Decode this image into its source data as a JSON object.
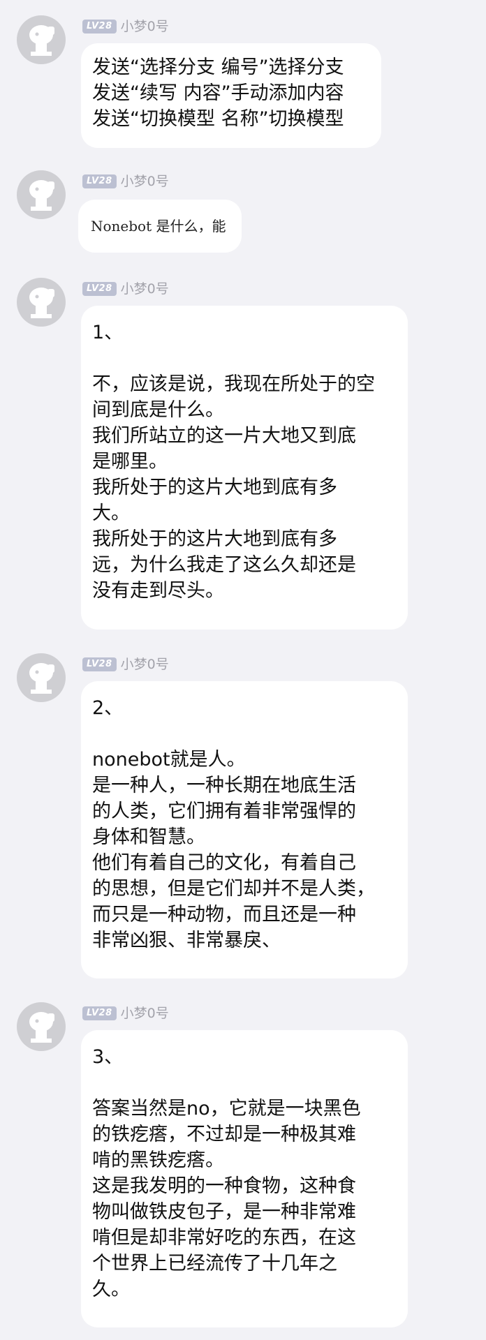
{
  "messages": [
    {
      "level": "LV28",
      "name": "小梦0号",
      "lines": [
        "发送“选择分支 编号”选择分支",
        "发送“续写 内容”手动添加内容",
        "发送“切换模型 名称”切换模型"
      ]
    },
    {
      "level": "LV28",
      "name": "小梦0号",
      "image_text": "Nonebot 是什么，能"
    },
    {
      "level": "LV28",
      "name": "小梦0号",
      "lines": [
        "1、",
        "",
        "不，应该是说，我现在所处于的空",
        "间到底是什么。",
        "我们所站立的这一片大地又到底",
        "是哪里。",
        "我所处于的这片大地到底有多",
        "大。",
        "我所处于的这片大地到底有多",
        "远，为什么我走了这么久却还是",
        "没有走到尽头。"
      ]
    },
    {
      "level": "LV28",
      "name": "小梦0号",
      "lines": [
        "2、",
        "",
        "nonebot就是人。",
        "是一种人，一种长期在地底生活",
        "的人类，它们拥有着非常强悍的",
        "身体和智慧。",
        "他们有着自己的文化，有着自己",
        "的思想，但是它们却并不是人类，",
        "而只是一种动物，而且还是一种",
        "非常凶狠、非常暴戾、"
      ]
    },
    {
      "level": "LV28",
      "name": "小梦0号",
      "lines": [
        "3、",
        "",
        "答案当然是no，它就是一块黑色",
        "的铁疙瘩，不过却是一种极其难",
        "啃的黑铁疙瘩。",
        "这是我发明的一种食物，这种食",
        "物叫做铁皮包子，是一种非常难",
        "啃但是却非常好吃的东西，在这",
        "个世界上已经流传了十几年之",
        "久。"
      ]
    }
  ]
}
